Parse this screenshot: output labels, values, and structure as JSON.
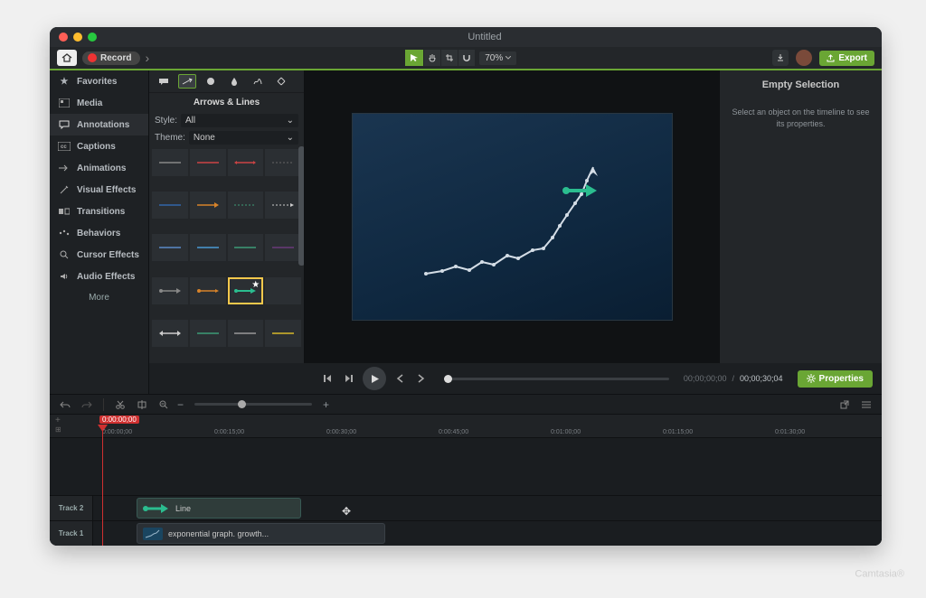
{
  "titlebar": {
    "title": "Untitled"
  },
  "toolbar": {
    "record_label": "Record",
    "zoom_value": "70%",
    "export_label": "Export"
  },
  "sidebar": {
    "items": [
      {
        "icon": "star",
        "label": "Favorites"
      },
      {
        "icon": "media",
        "label": "Media"
      },
      {
        "icon": "annot",
        "label": "Annotations"
      },
      {
        "icon": "cc",
        "label": "Captions"
      },
      {
        "icon": "anim",
        "label": "Animations"
      },
      {
        "icon": "vfx",
        "label": "Visual Effects"
      },
      {
        "icon": "trans",
        "label": "Transitions"
      },
      {
        "icon": "behav",
        "label": "Behaviors"
      },
      {
        "icon": "cursor",
        "label": "Cursor Effects"
      },
      {
        "icon": "audio",
        "label": "Audio Effects"
      }
    ],
    "more_label": "More"
  },
  "library": {
    "title": "Arrows & Lines",
    "style_label": "Style:",
    "style_value": "All",
    "theme_label": "Theme:",
    "theme_value": "None"
  },
  "properties_panel": {
    "title": "Empty Selection",
    "message": "Select an object on the timeline to see its properties."
  },
  "playbar": {
    "time_left": "00;00;00;00",
    "time_sep": "/",
    "time_right": "00;00;30;04",
    "properties_label": "Properties"
  },
  "timeline": {
    "playhead_time": "0:00:00;00",
    "ticks": [
      "0:00:00;00",
      "0:00:15;00",
      "0:00:30;00",
      "0:00:45;00",
      "0:01:00;00",
      "0:01:15;00",
      "0:01:30;00"
    ],
    "tracks": {
      "track2_label": "Track 2",
      "track1_label": "Track 1",
      "clip_line_label": "Line",
      "clip_graph_label": "exponential graph. growth..."
    }
  },
  "watermark": "Camtasia"
}
